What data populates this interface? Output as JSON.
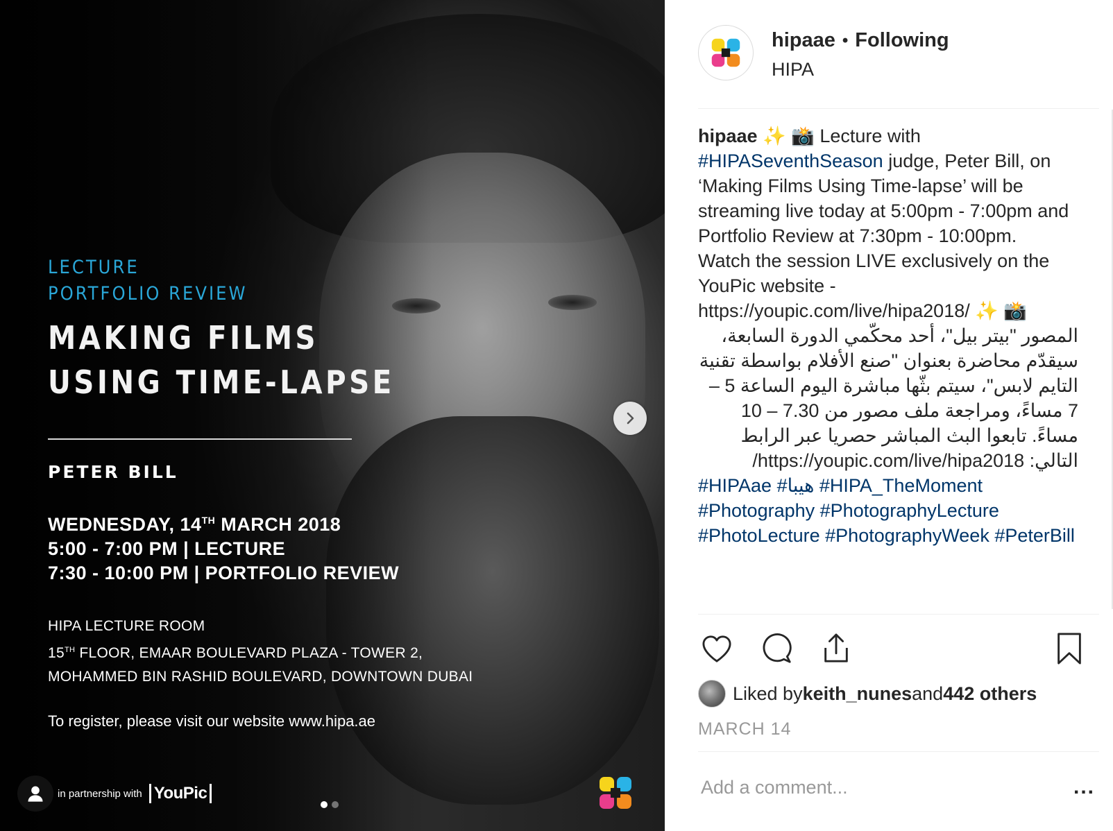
{
  "post_image": {
    "tag_lecture": "LECTURE",
    "tag_portfolio": "PORTFOLIO REVIEW",
    "title_line1": "MAKING FILMS",
    "title_line2": "USING TIME-LAPSE",
    "speaker": "PETER BILL",
    "date_prefix": "WEDNESDAY, 14",
    "date_sup": "TH",
    "date_suffix": " MARCH 2018",
    "time_lecture": "5:00 - 7:00 PM | LECTURE",
    "time_review": "7:30 - 10:00 PM | PORTFOLIO REVIEW",
    "venue_line1": "HIPA LECTURE ROOM",
    "venue_line2_prefix": "15",
    "venue_line2_sup": "TH",
    "venue_line2_suffix": " FLOOR, EMAAR BOULEVARD  PLAZA - TOWER 2,",
    "venue_line3": "MOHAMMED BIN RASHID BOULEVARD, DOWNTOWN DUBAI",
    "register": "To register, please visit our website www.hipa.ae",
    "partner_text": "in partnership with",
    "partner_brand": "YouPic",
    "carousel": {
      "total": 2,
      "active": 1
    }
  },
  "header": {
    "username": "hipaae",
    "separator": "•",
    "follow_status": "Following",
    "subtitle": "HIPA"
  },
  "caption": {
    "username": "hipaae",
    "emoji_open": "✨ 📸",
    "text_1": " Lecture with ",
    "hashtag_season": "#HIPASeventhSeason",
    "text_2": " judge, Peter Bill, on ‘Making Films Using Time-lapse’ will be streaming live today at 5:00pm - 7:00pm and Portfolio Review at 7:30pm - 10:00pm.",
    "text_3": "Watch the session LIVE exclusively on the YouPic website - https://youpic.com/live/hipa2018/ ✨ 📸",
    "arabic_1": "المصور \"بيتر بيل\"، أحد محكّمي الدورة السابعة، سيقدّم محاضرة بعنوان \"صنع الأفلام بواسطة تقنية التايم لابس\"، سيتم بثّها مباشرة اليوم الساعة 5 – 7 مساءً، ومراجعة ملف مصور من 7.30 – 10 مساءً. تابعوا البث المباشر حصريا عبر الرابط التالي: https://youpic.com/live/hipa2018/",
    "hashtags": [
      "#HIPAae",
      "#هيبا",
      "#HIPA_TheMoment",
      "#Photography",
      "#PhotographyLecture",
      "#PhotoLecture",
      "#PhotographyWeek",
      "#PeterBill"
    ]
  },
  "actions": {
    "like_icon": "heart-icon",
    "comment_icon": "comment-icon",
    "share_icon": "share-icon",
    "save_icon": "bookmark-icon"
  },
  "likes": {
    "prefix": "Liked by ",
    "user": "keith_nunes",
    "middle": " and ",
    "others": "442 others"
  },
  "date": "MARCH 14",
  "comment": {
    "placeholder": "Add a comment...",
    "more": "..."
  },
  "colors": {
    "hashtag": "#003569",
    "tag_blue": "#2aa7d8",
    "muted": "#999999"
  }
}
